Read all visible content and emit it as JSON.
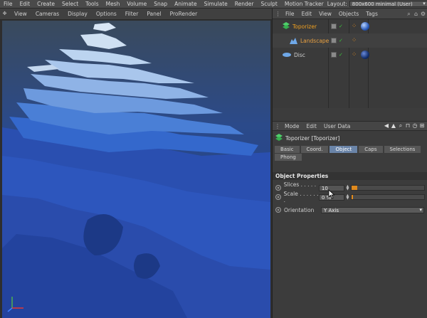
{
  "menubar": {
    "items": [
      "File",
      "Edit",
      "Create",
      "Select",
      "Tools",
      "Mesh",
      "Volume",
      "Snap",
      "Animate",
      "Simulate",
      "Render",
      "Sculpt",
      "Motion Tracker"
    ],
    "layout_label": "Layout:",
    "layout_value": "800x600 minimal (User)"
  },
  "viewport": {
    "menu": [
      "View",
      "Cameras",
      "Display",
      "Options",
      "Filter",
      "Panel",
      "ProRender"
    ],
    "colors": {
      "background_dark": "#1f3f8a",
      "background_mid": "#2c55b5",
      "layer_top": "#cfe0f2"
    }
  },
  "object_manager": {
    "menu": [
      "File",
      "Edit",
      "View",
      "Objects",
      "Tags"
    ],
    "objects": [
      {
        "name": "Toporizer",
        "color": "#f0a020",
        "icon": "toporizer-icon"
      },
      {
        "name": "Landscape",
        "color": "#e8a040",
        "icon": "landscape-icon"
      },
      {
        "name": "Disc",
        "color": "#cfcfcf",
        "icon": "disc-icon"
      }
    ]
  },
  "attribute_manager": {
    "menu": [
      "Mode",
      "Edit",
      "User Data"
    ],
    "object_title": "Toporizer [Toporizer]",
    "tabs": [
      "Basic",
      "Coord.",
      "Object",
      "Caps",
      "Selections",
      "Phong"
    ],
    "active_tab": "Object",
    "section": "Object Properties",
    "props": {
      "slices": {
        "label": "Slices . . . . . .",
        "value": "10",
        "fill_fraction": 0.08
      },
      "scale": {
        "label": "Scale . . . . . . .",
        "value": "0 %",
        "fill_fraction": 0.0
      },
      "orientation": {
        "label": "Orientation",
        "value": "Y Axis"
      }
    },
    "accent": "#e08a1e"
  }
}
